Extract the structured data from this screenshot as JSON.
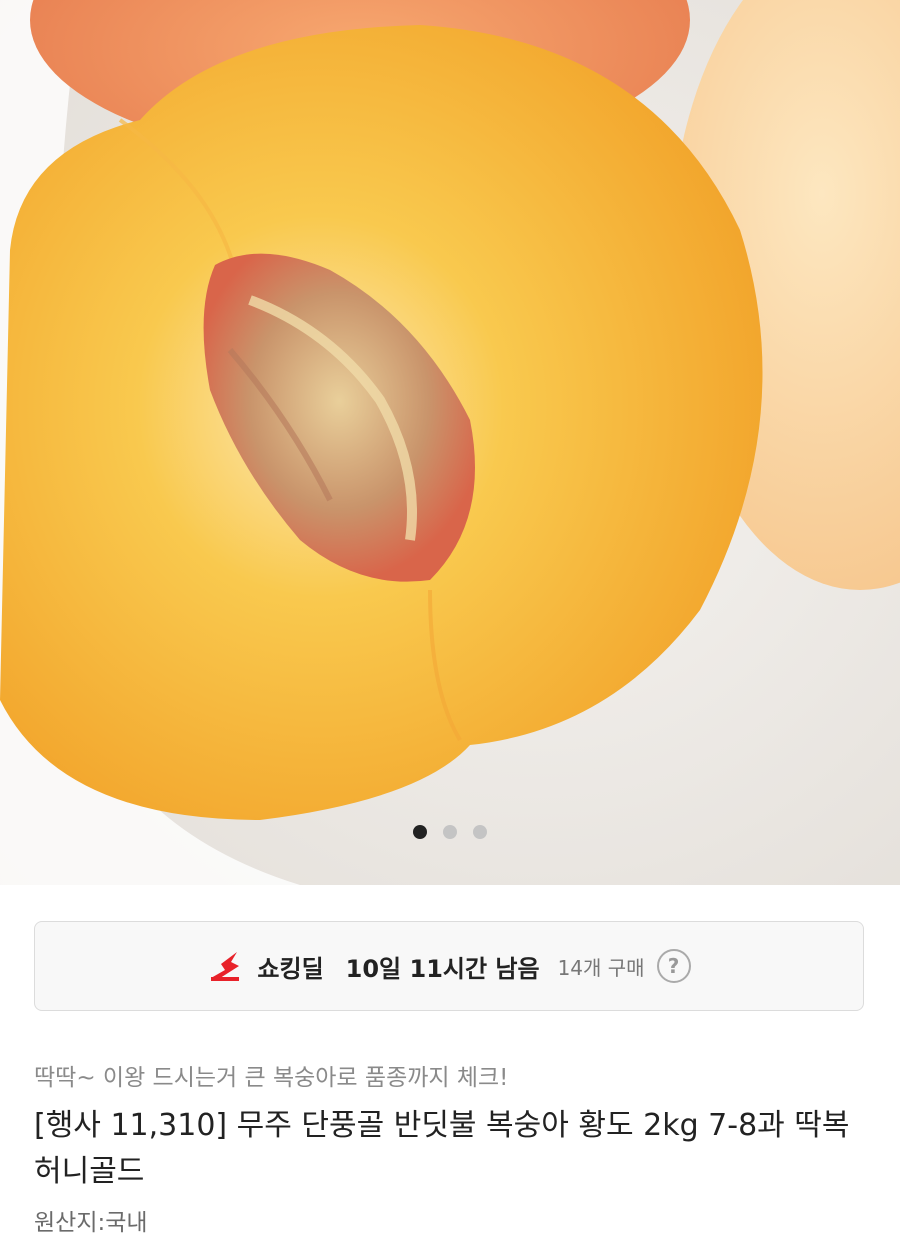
{
  "product_image": {
    "name": "peach-image",
    "slide_count": 3,
    "active_slide": 1
  },
  "deal": {
    "icon": "shocking-deal-icon",
    "title": "쇼킹딜",
    "remaining": "10일 11시간 남음",
    "purchase_count": "14개 구매",
    "help": "?"
  },
  "product": {
    "subtitle": "딱딱~ 이왕 드시는거 큰 복숭아로 품종까지 체크!",
    "title": "[행사 11,310] 무주 단풍골 반딧불 복숭아 황도 2kg 7-8과 딱복 허니골드",
    "origin": "원산지:국내"
  },
  "colors": {
    "accent": "#e8222a",
    "active_dot": "#222222",
    "inactive_dot": "#c4c4c4"
  }
}
